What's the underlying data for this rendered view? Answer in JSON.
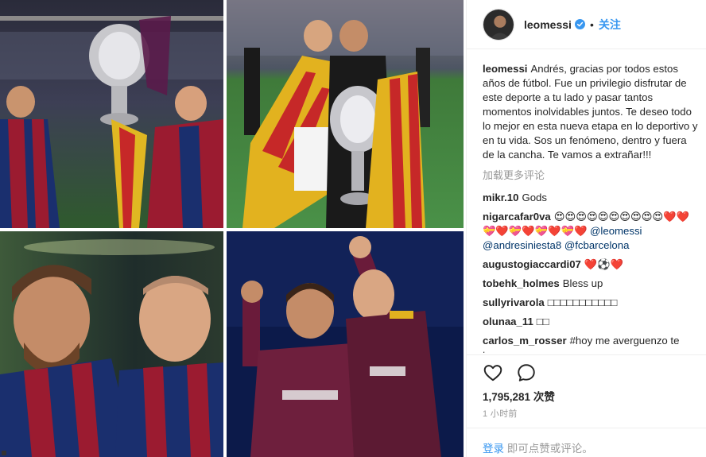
{
  "post": {
    "username": "leomessi",
    "follow_label": "关注",
    "dot": "•"
  },
  "caption": {
    "username": "leomessi",
    "text": "Andrés, gracias por todos estos años de fútbol. Fue un privilegio disfrutar de este deporte a tu lado y pasar tantos momentos inolvidables juntos. Te deseo todo lo mejor en esta nueva etapa en lo deportivo y en tu vida. Sos un fenómeno, dentro y fuera de la cancha. Te vamos a extrañar!!!"
  },
  "load_more": "加载更多评论",
  "comments": [
    {
      "username": "mikr.10",
      "text": "Gods"
    },
    {
      "username": "nigarcafar0va",
      "text": "😍😍😍😍😍😍😍😍😍😍❤️❤️💝❤️💝❤️💝❤️💝❤️",
      "mentions": [
        "@leomessi",
        "@andresiniesta8",
        "@fcbarcelona"
      ]
    },
    {
      "username": "augustogiaccardi07",
      "text": "❤️⚽❤️"
    },
    {
      "username": "tobehk_holmes",
      "text": "Bless up"
    },
    {
      "username": "sullyrivarola",
      "text": "□□□□□□□□□□□"
    },
    {
      "username": "olunaa_11",
      "text": "□□"
    },
    {
      "username": "carlos_m_rosser",
      "text": "#hoy me averguenzo te toca"
    }
  ],
  "likes": {
    "count": "1,795,281",
    "label": "次赞"
  },
  "timestamp": "1 小时前",
  "login": {
    "link": "登录",
    "text": "即可点赞或评论。"
  },
  "icons": {
    "like": "heart-icon",
    "comment": "comment-bubble-icon",
    "verified": "verified-badge-icon"
  },
  "colors": {
    "link_blue": "#3897f0",
    "mention_blue": "#003569",
    "muted": "#999999",
    "barca_blue": "#1a2f6e",
    "barca_red": "#9b1b30"
  }
}
